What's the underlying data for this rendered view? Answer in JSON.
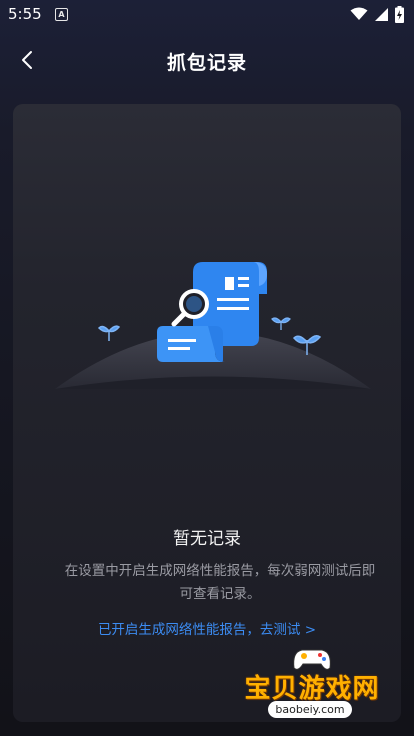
{
  "status_bar": {
    "time": "5:55",
    "notification_icon_letter": "A",
    "icons": [
      "wifi-icon",
      "signal-icon",
      "battery-charging-icon"
    ]
  },
  "header": {
    "title": "抓包记录",
    "back_icon": "chevron-left-icon"
  },
  "empty_state": {
    "title": "暂无记录",
    "description": "在设置中开启生成网络性能报告，每次弱网测试后即可查看记录。",
    "link": "已开启生成网络性能报告，去测试 >"
  },
  "watermark": {
    "text": "宝贝游戏网",
    "url": "baobeiy.com"
  },
  "colors": {
    "accent": "#3c8cf2",
    "illustration_blue": "#2f86f0",
    "background": "#15151c",
    "card": "#23242d"
  }
}
